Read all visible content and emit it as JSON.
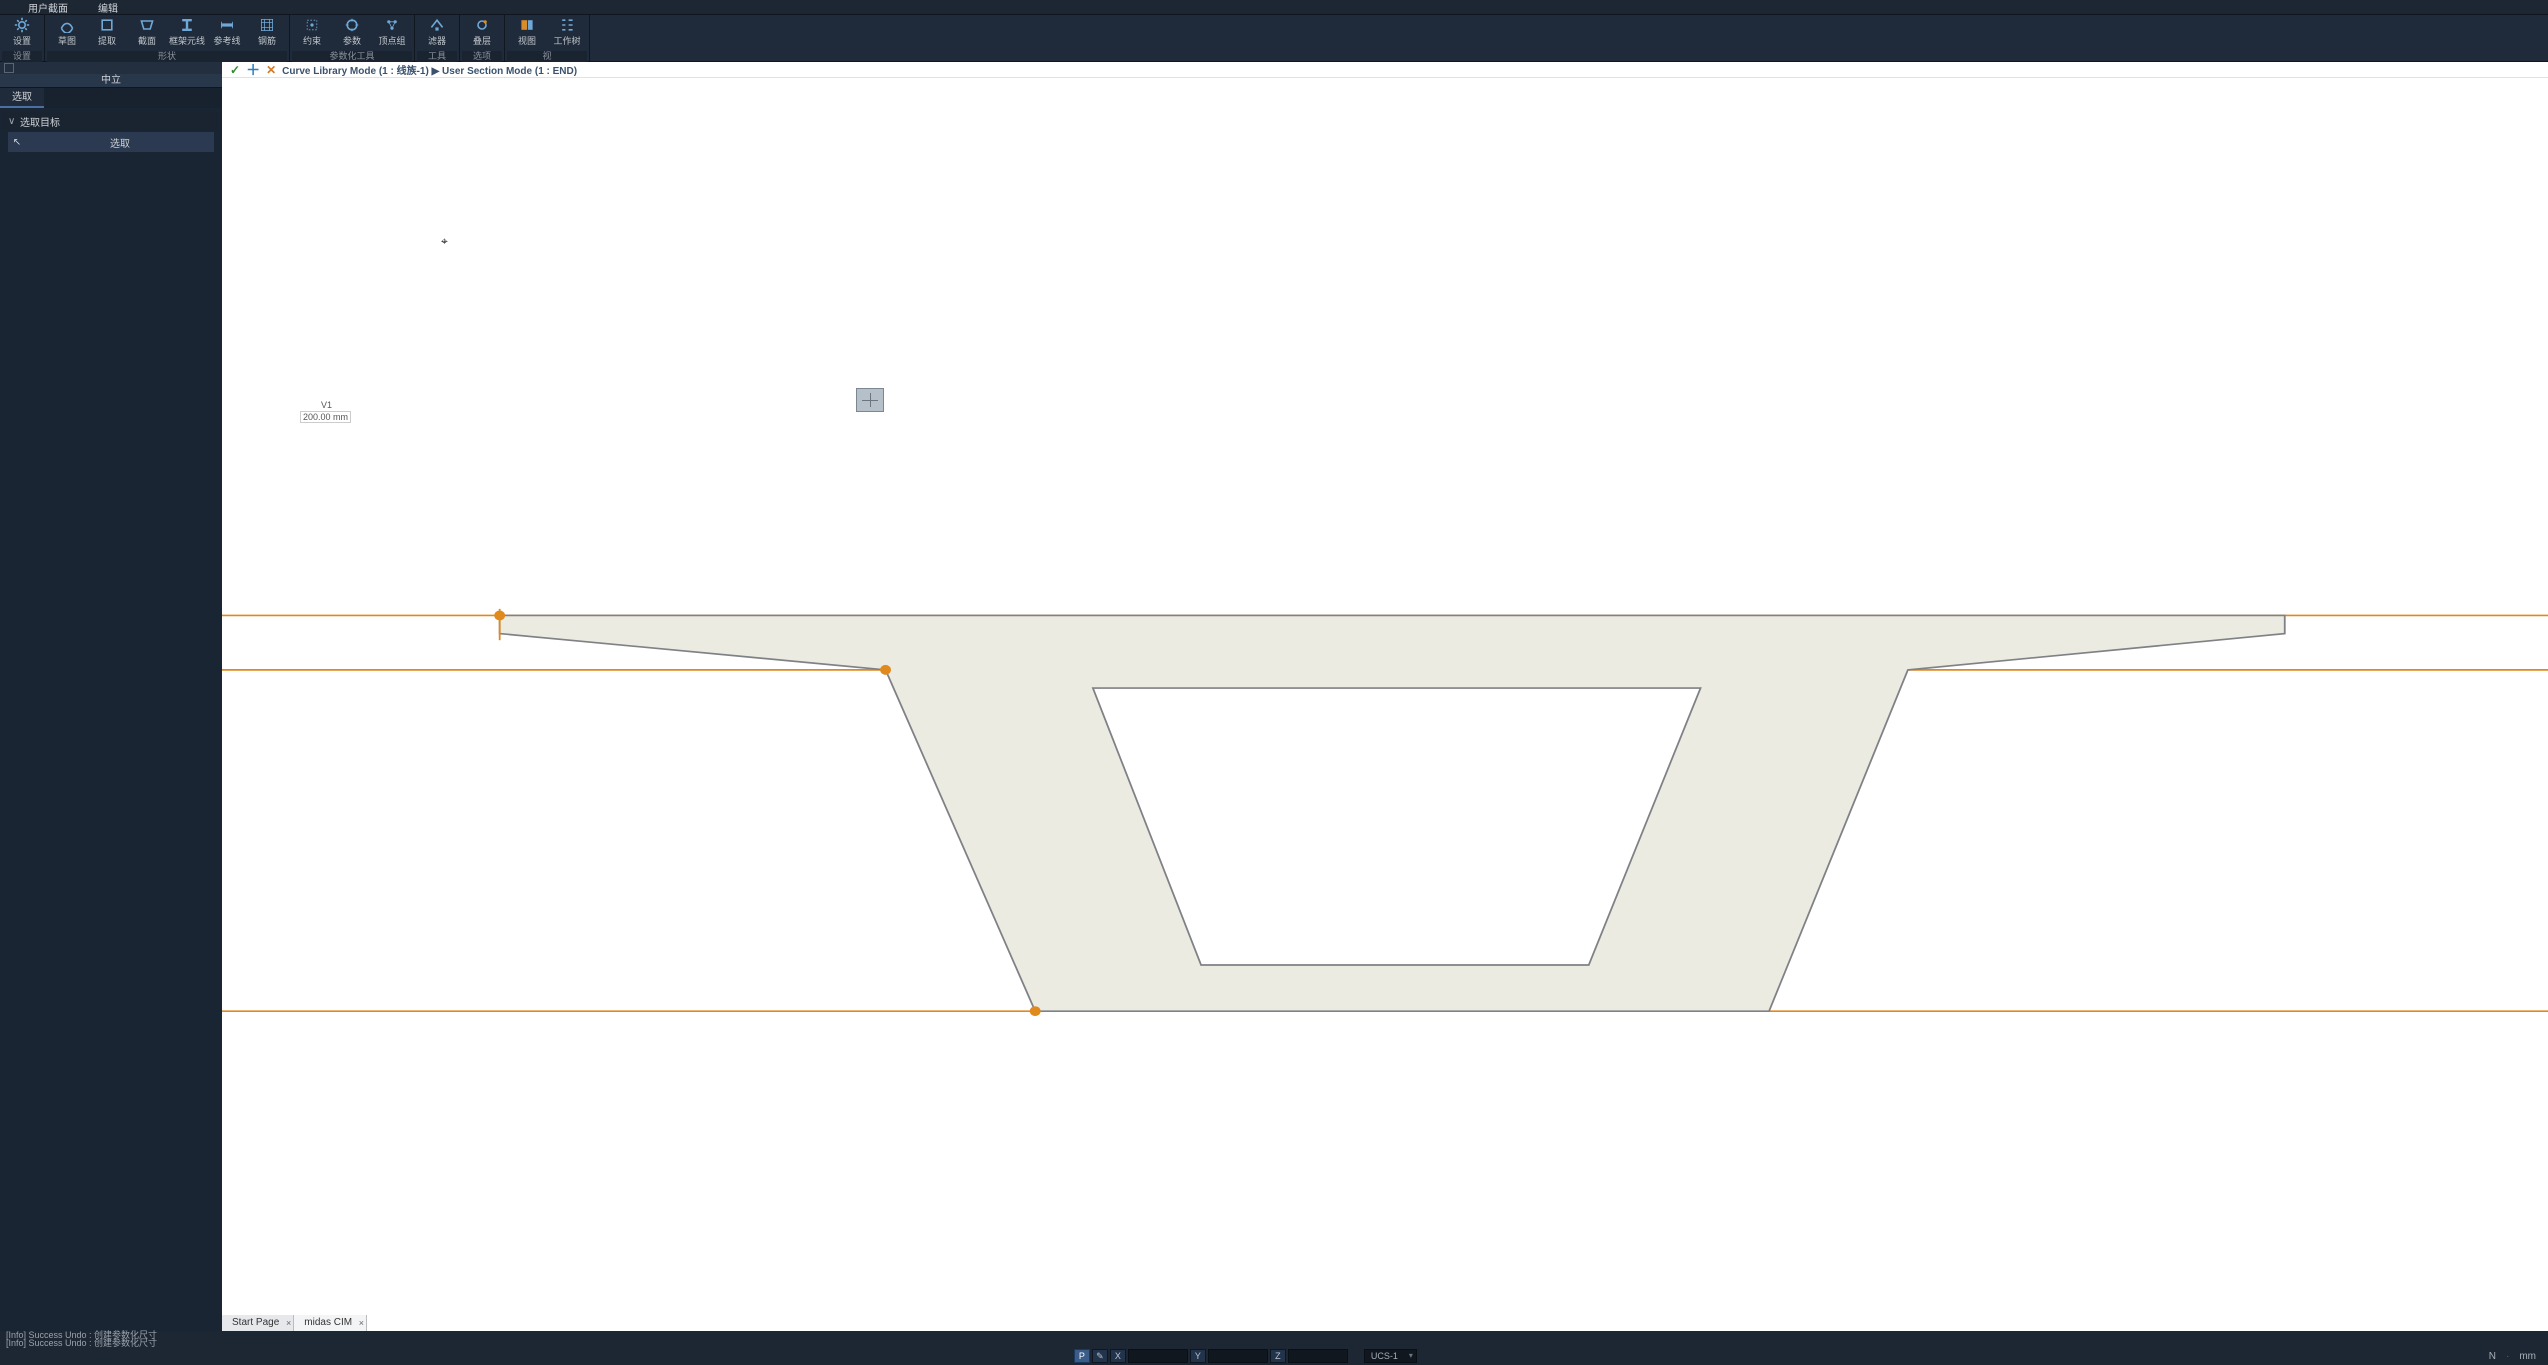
{
  "menu": {
    "user_section": "用户截面",
    "edit": "编辑"
  },
  "ribbon": {
    "groups": [
      {
        "label": "设置",
        "items": [
          {
            "name": "settings",
            "label": "设置",
            "icon": "gear"
          }
        ]
      },
      {
        "label": "形状",
        "items": [
          {
            "name": "sketch",
            "label": "草图",
            "icon": "pencil"
          },
          {
            "name": "extract",
            "label": "提取",
            "icon": "box"
          },
          {
            "name": "section",
            "label": "截面",
            "icon": "trapezoid"
          },
          {
            "name": "frame-element",
            "label": "框架元线",
            "icon": "ibeam"
          },
          {
            "name": "reference-line",
            "label": "参考线",
            "icon": "refline"
          },
          {
            "name": "rebar",
            "label": "钢筋",
            "icon": "rebar"
          }
        ]
      },
      {
        "label": "参数化工具",
        "items": [
          {
            "name": "constraint",
            "label": "约束",
            "icon": "constraint"
          },
          {
            "name": "parameter",
            "label": "参数",
            "icon": "param"
          },
          {
            "name": "vertex-group",
            "label": "顶点组",
            "icon": "vertex"
          }
        ]
      },
      {
        "label": "工具",
        "items": [
          {
            "name": "filter",
            "label": "滤器",
            "icon": "filter"
          }
        ]
      },
      {
        "label": "选项",
        "items": [
          {
            "name": "options",
            "label": "叠层",
            "icon": "overlay"
          }
        ]
      },
      {
        "label": "视",
        "items": [
          {
            "name": "view",
            "label": "视图",
            "icon": "view"
          },
          {
            "name": "worktree",
            "label": "工作树",
            "icon": "tree"
          }
        ]
      }
    ]
  },
  "side": {
    "title": "中立",
    "tab": "选取",
    "section_header": "选取目标",
    "row_label": "选取"
  },
  "breadcrumb": "Curve Library Mode (1 : 线族-1) ▶ User Section Mode (1 : END)",
  "dimension": {
    "variable": "V1",
    "value": "200.00 mm"
  },
  "doc_tabs": [
    {
      "label": "Start Page",
      "active": false
    },
    {
      "label": "midas CIM",
      "active": true
    }
  ],
  "log": [
    "[Info] Success Undo : 创建参数化尺寸",
    "[Info] Success Undo : 创建参数化尺寸"
  ],
  "status": {
    "snap_label": "P",
    "axes": [
      "X",
      "Y",
      "Z"
    ],
    "ucs": "UCS-1",
    "n_label": "N",
    "unit": "mm"
  }
}
